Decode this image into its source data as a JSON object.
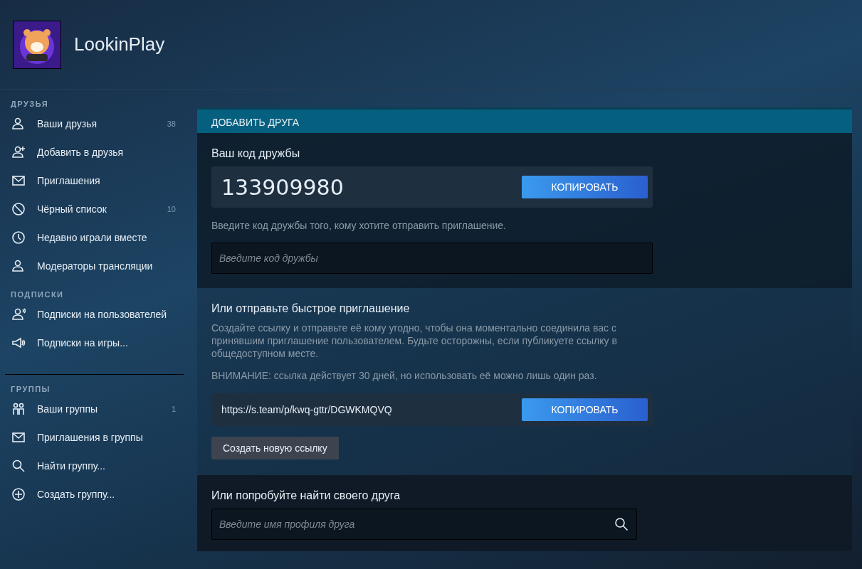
{
  "profile": {
    "name": "LookinPlay"
  },
  "sidebar": {
    "sections": [
      {
        "title": "ДРУЗЬЯ",
        "items": [
          {
            "label": "Ваши друзья",
            "kind": "person",
            "count": "38"
          },
          {
            "label": "Добавить в друзья",
            "kind": "person-add"
          },
          {
            "label": "Приглашения",
            "kind": "envelope"
          },
          {
            "label": "Чёрный список",
            "kind": "blocked",
            "count": "10"
          },
          {
            "label": "Недавно играли вместе",
            "kind": "clock"
          },
          {
            "label": "Модераторы трансляции",
            "kind": "person"
          }
        ]
      },
      {
        "title": "ПОДПИСКИ",
        "items": [
          {
            "label": "Подписки на пользователей",
            "kind": "person-broadcast"
          },
          {
            "label": "Подписки на игры...",
            "kind": "megaphone"
          }
        ]
      },
      {
        "title": "ГРУППЫ",
        "items": [
          {
            "label": "Ваши группы",
            "kind": "people",
            "count": "1"
          },
          {
            "label": "Приглашения в группы",
            "kind": "envelope"
          },
          {
            "label": "Найти группу...",
            "kind": "search"
          },
          {
            "label": "Создать группу...",
            "kind": "plus-circle"
          }
        ]
      }
    ]
  },
  "panel": {
    "title": "ДОБАВИТЬ ДРУГА",
    "friend_code": {
      "heading": "Ваш код дружбы",
      "code": "133909980",
      "copy_button": "КОПИРОВАТЬ",
      "hint": "Введите код дружбы того, кому хотите отправить приглашение.",
      "input": {
        "placeholder": "Введите код дружбы"
      }
    },
    "quick_invite": {
      "heading": "Или отправьте быстрое приглашение",
      "description": "Создайте ссылку и отправьте её кому угодно, чтобы она моментально соединила вас с принявшим приглашение пользователем. Будьте осторожны, если публикуете ссылку в общедоступном месте.",
      "warning": "ВНИМАНИЕ: ссылка действует 30 дней, но использовать её можно лишь один раз.",
      "link": "https://s.team/p/kwq-gttr/DGWKMQVQ",
      "copy_button": "КОПИРОВАТЬ",
      "new_link_button": "Создать новую ссылку"
    },
    "search": {
      "heading": "Или попробуйте найти своего друга",
      "input": {
        "placeholder": "Введите имя профиля друга"
      }
    }
  }
}
